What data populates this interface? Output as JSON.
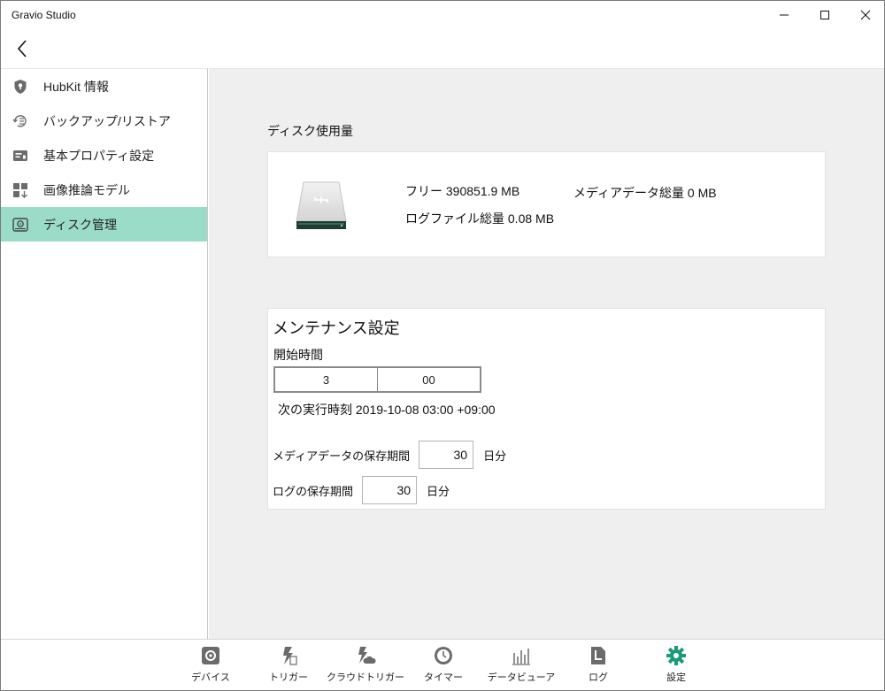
{
  "window": {
    "title": "Gravio Studio"
  },
  "sidebar": {
    "items": [
      {
        "label": "HubKit 情報",
        "icon": "shield-icon"
      },
      {
        "label": "バックアップ/リストア",
        "icon": "backup-restore-icon"
      },
      {
        "label": "基本プロパティ設定",
        "icon": "properties-icon"
      },
      {
        "label": "画像推論モデル",
        "icon": "model-icon"
      },
      {
        "label": "ディスク管理",
        "icon": "disk-icon",
        "active": true
      }
    ],
    "active_color": "#9adcc8"
  },
  "disk_usage": {
    "section_title": "ディスク使用量",
    "free": "フリー 390851.9 MB",
    "log_total": "ログファイル総量 0.08 MB",
    "media_total": "メディアデータ総量 0 MB"
  },
  "maintenance": {
    "title": "メンテナンス設定",
    "start_label": "開始時間",
    "start_hour": "3",
    "start_minute": "00",
    "next_run": "次の実行時刻 2019-10-08 03:00 +09:00",
    "media_retention_label": "メディアデータの保存期間",
    "media_retention_value": "30",
    "media_retention_unit": "日分",
    "log_retention_label": "ログの保存期間",
    "log_retention_value": "30",
    "log_retention_unit": "日分"
  },
  "bottom_nav": {
    "items": [
      {
        "label": "デバイス",
        "icon": "gear-icon"
      },
      {
        "label": "トリガー",
        "icon": "trigger-icon"
      },
      {
        "label": "クラウドトリガー",
        "icon": "cloud-trigger-icon"
      },
      {
        "label": "タイマー",
        "icon": "clock-icon"
      },
      {
        "label": "データビューア",
        "icon": "bar-chart-icon"
      },
      {
        "label": "ログ",
        "icon": "log-icon"
      },
      {
        "label": "設定",
        "icon": "settings-icon",
        "active": true
      }
    ],
    "active_color": "#1a9b7a"
  }
}
